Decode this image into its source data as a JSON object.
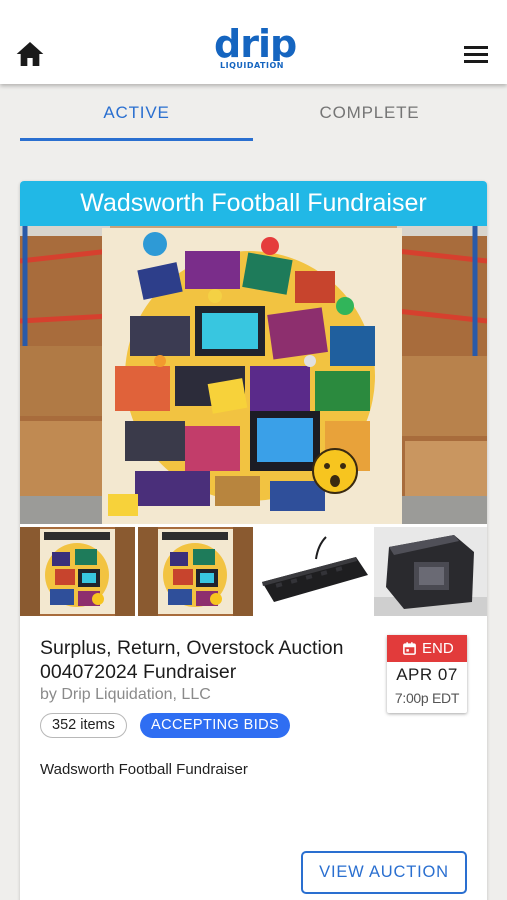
{
  "header": {
    "home_icon": "home-icon",
    "menu_icon": "hamburger-menu-icon",
    "logo": {
      "main": "drip",
      "sub": "LIQUIDATION"
    }
  },
  "tabs": [
    {
      "label": "ACTIVE",
      "selected": true
    },
    {
      "label": "COMPLETE",
      "selected": false
    }
  ],
  "auction": {
    "header_title": "Wadsworth Football Fundraiser",
    "title": "Surplus, Return, Overstock Auction 004072024 Fundraiser",
    "byline": "by Drip Liquidation, LLC",
    "item_count": "352 items",
    "status": "ACCEPTING BIDS",
    "description": "Wadsworth Football Fundraiser",
    "end": {
      "label": "END",
      "icon": "calendar-icon",
      "month": "APR",
      "day": "07",
      "time": "7:00p EDT"
    },
    "view_button": "VIEW AUCTION",
    "carousel": {
      "active_index": 0,
      "count": 2
    }
  },
  "colors": {
    "brand_blue": "#2a6fd0",
    "header_cyan": "#21b8e6",
    "end_red": "#e23b3b",
    "status_blue": "#2f6ef2"
  }
}
